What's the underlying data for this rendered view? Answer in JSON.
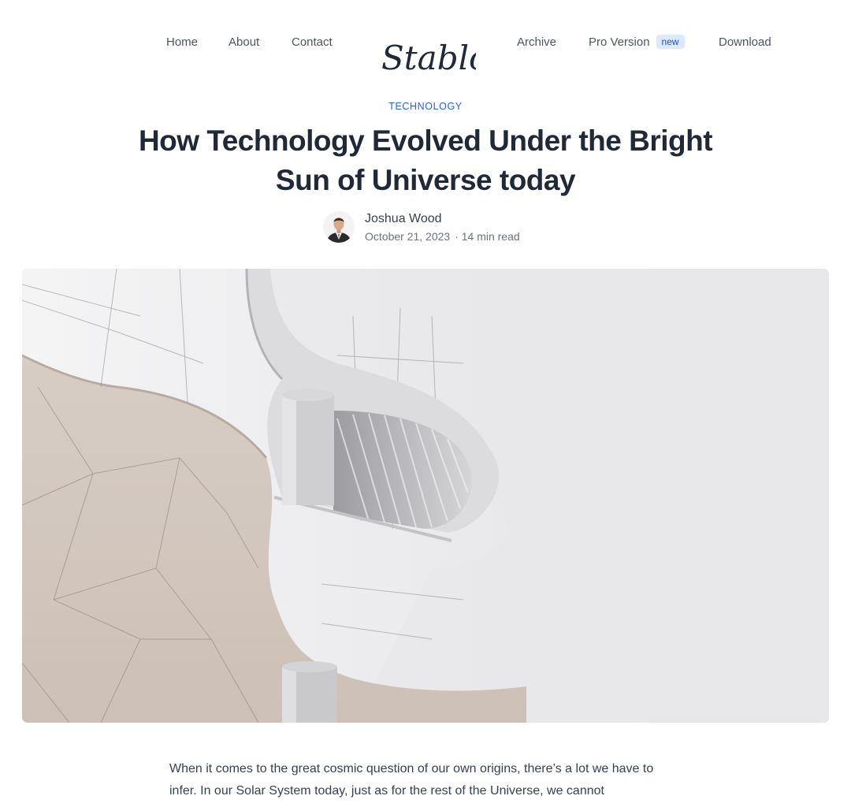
{
  "nav": {
    "home": "Home",
    "about": "About",
    "contact": "Contact",
    "logo": "Stablo",
    "archive": "Archive",
    "pro": "Pro Version",
    "pro_badge": "new",
    "download": "Download"
  },
  "post": {
    "category": "TECHNOLOGY",
    "title": "How Technology Evolved Under the Bright Sun of Universe today",
    "author": "Joshua Wood",
    "date": "October 21, 2023",
    "read_time": "· 14 min read",
    "body": "When it comes to the great cosmic question of our own origins, there’s a lot we have to infer. In our Solar System today, just as for the rest of the Universe, we cannot"
  }
}
